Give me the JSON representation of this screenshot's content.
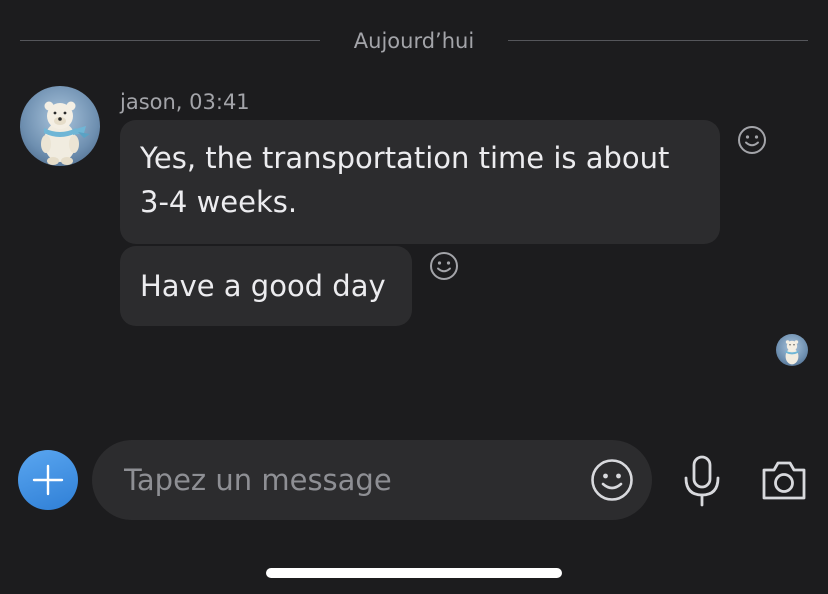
{
  "conversation": {
    "date_divider": "Aujourd’hui",
    "messages": [
      {
        "sender": "jason, 03:41",
        "text": "Yes, the transportation time is about 3-4 weeks."
      },
      {
        "text": "Have a good day"
      }
    ]
  },
  "composer": {
    "placeholder": "Tapez un message"
  },
  "icons": {
    "avatar": "polar-bear-avatar",
    "reaction": "smiley-face-icon",
    "add": "plus-icon",
    "emoji": "smiley-face-icon",
    "mic": "microphone-icon",
    "camera": "camera-icon"
  },
  "colors": {
    "background": "#1c1c1e",
    "bubble": "#2c2c2e",
    "accent": "#3d8fe3",
    "secondary_text": "#a3a4a9"
  }
}
